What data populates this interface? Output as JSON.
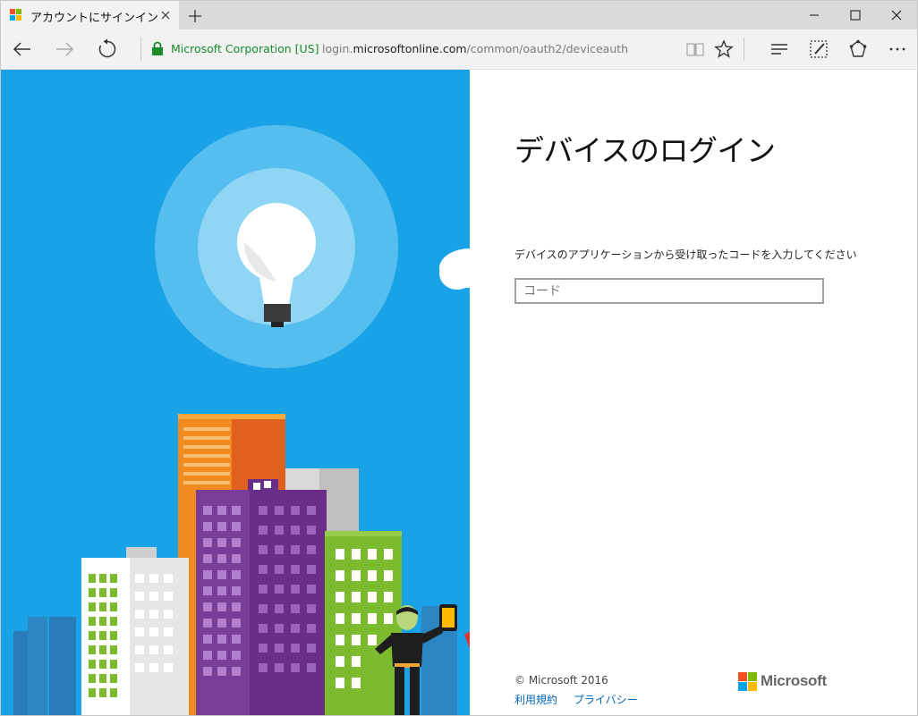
{
  "tab": {
    "title": "アカウントにサインイン",
    "close_icon": "close-icon"
  },
  "window_controls": [
    "minimize-icon",
    "maximize-icon",
    "close-icon"
  ],
  "address_bar": {
    "certificate": "Microsoft Corporation [US]",
    "url_prefix": "login.",
    "url_domain": "microsoftonline.com",
    "url_path": "/common/oauth2/deviceauth"
  },
  "toolbar_icons": [
    "reading-view-icon",
    "favorite-star-icon",
    "hub-icon",
    "web-note-icon",
    "share-icon",
    "more-icon"
  ],
  "page": {
    "heading": "デバイスのログイン",
    "description": "デバイスのアプリケーションから受け取ったコードを入力してください",
    "code_placeholder": "コード",
    "code_value": "",
    "copyright": "© Microsoft 2016",
    "links": [
      "利用規約",
      "プライバシー"
    ],
    "logo_text": "Microsoft"
  },
  "colors": {
    "illustration_bg": "#1aa2e6",
    "link": "#0067b8",
    "secure_green": "#188a2a",
    "ms_red": "#f25022",
    "ms_green": "#7fba00",
    "ms_blue": "#00a4ef",
    "ms_yellow": "#ffb900"
  }
}
